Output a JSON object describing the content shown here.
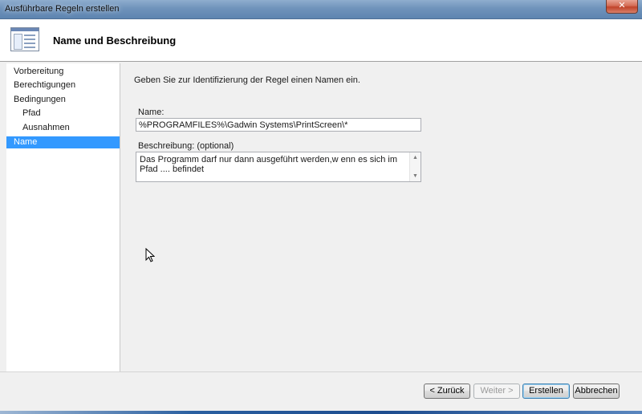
{
  "window": {
    "title": "Ausführbare Regeln erstellen",
    "close_label": "✕"
  },
  "header": {
    "title": "Name und Beschreibung",
    "icon": "wizard-page-icon"
  },
  "nav": {
    "items": [
      {
        "label": "Vorbereitung"
      },
      {
        "label": "Berechtigungen"
      },
      {
        "label": "Bedingungen"
      },
      {
        "label": "Pfad"
      },
      {
        "label": "Ausnahmen"
      },
      {
        "label": "Name"
      }
    ],
    "selected_color": "#3399ff"
  },
  "main": {
    "intro": "Geben Sie zur Identifizierung der Regel einen Namen ein.",
    "name_label": "Name:",
    "name_value": "%PROGRAMFILES%\\Gadwin Systems\\PrintScreen\\*",
    "description_label": "Beschreibung: (optional)",
    "description_value": "Das Programm darf nur dann ausgeführt werden,w enn es sich im Pfad .... befindet"
  },
  "buttons": {
    "back": "< Zurück",
    "next": "Weiter >",
    "create": "Erstellen",
    "cancel": "Abbrechen"
  }
}
